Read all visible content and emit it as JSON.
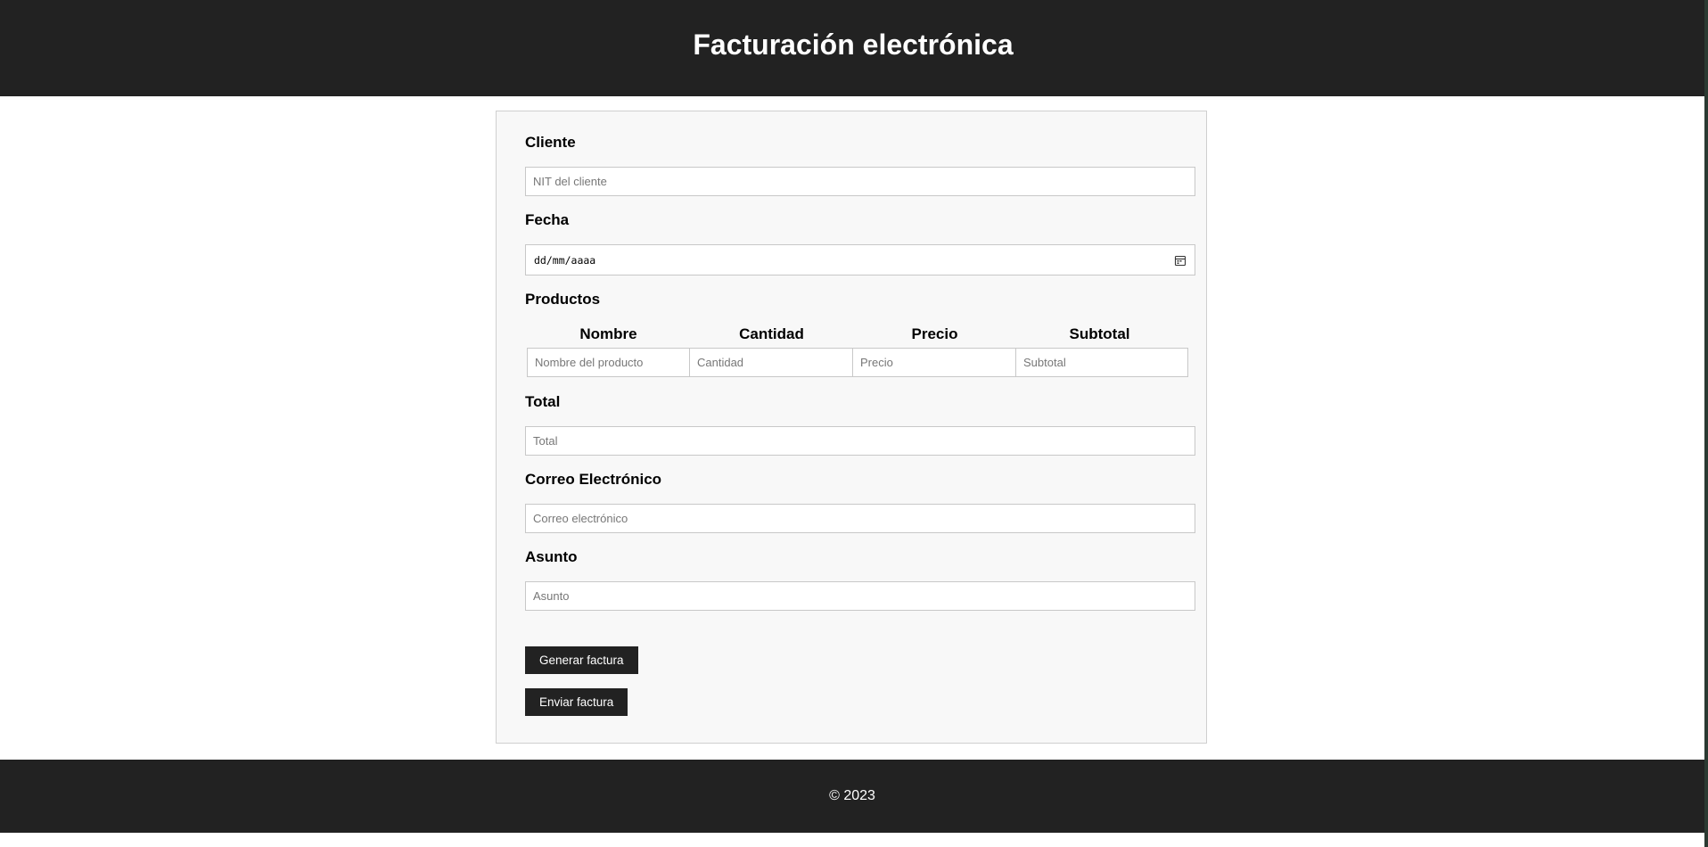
{
  "header": {
    "title": "Facturación electrónica"
  },
  "form": {
    "cliente": {
      "label": "Cliente",
      "placeholder": "NIT del cliente"
    },
    "fecha": {
      "label": "Fecha",
      "display": "dd/mm/aaaa",
      "icon": "calendar-icon"
    },
    "productos": {
      "label": "Productos",
      "columns": [
        "Nombre",
        "Cantidad",
        "Precio",
        "Subtotal"
      ],
      "placeholders": [
        "Nombre del producto",
        "Cantidad",
        "Precio",
        "Subtotal"
      ]
    },
    "total": {
      "label": "Total",
      "placeholder": "Total"
    },
    "correo": {
      "label": "Correo Electrónico",
      "placeholder": "Correo electrónico"
    },
    "asunto": {
      "label": "Asunto",
      "placeholder": "Asunto"
    },
    "buttons": {
      "generar": "Generar factura",
      "enviar": "Enviar factura"
    }
  },
  "footer": {
    "text": "© 2023"
  },
  "colors": {
    "header_bg": "#222222",
    "card_bg": "#f8f8f8",
    "button_bg": "#222222"
  }
}
